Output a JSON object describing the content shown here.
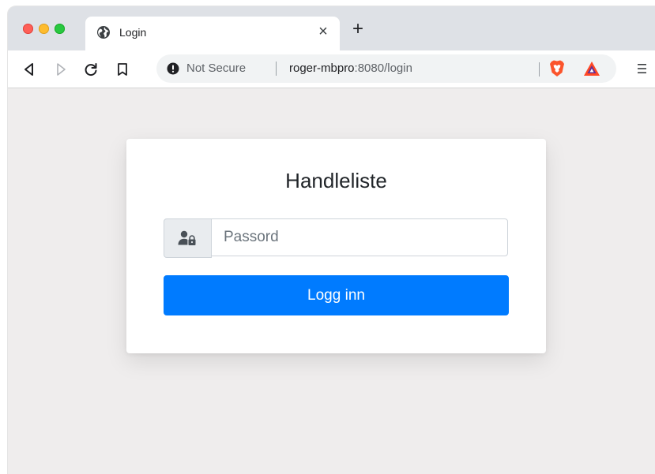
{
  "browser": {
    "tab": {
      "title": "Login",
      "close_label": "×"
    },
    "new_tab_label": "+",
    "address_bar": {
      "security_label": "Not Secure",
      "host": "roger-mbpro",
      "path": ":8080/login"
    },
    "icons": {
      "back": "back-arrow-icon",
      "forward": "forward-arrow-icon",
      "reload": "reload-icon",
      "bookmark": "bookmark-icon",
      "security": "info-warning-icon",
      "brave_shields": "brave-lion-icon",
      "brave_rewards": "bat-triangle-icon",
      "menu": "hamburger-menu-icon"
    },
    "colors": {
      "traffic_red": "#fe5f57",
      "traffic_yellow": "#febc2e",
      "traffic_green": "#28c840",
      "brave_orange": "#fb542b",
      "bat_red": "#ff4724",
      "bat_purple": "#662d91"
    }
  },
  "page": {
    "title": "Handleliste",
    "password_field": {
      "placeholder": "Passord",
      "value": "",
      "icon": "user-lock-icon"
    },
    "login_button_label": "Logg inn",
    "colors": {
      "primary": "#007bff",
      "background": "#efeded",
      "card": "#ffffff"
    }
  }
}
